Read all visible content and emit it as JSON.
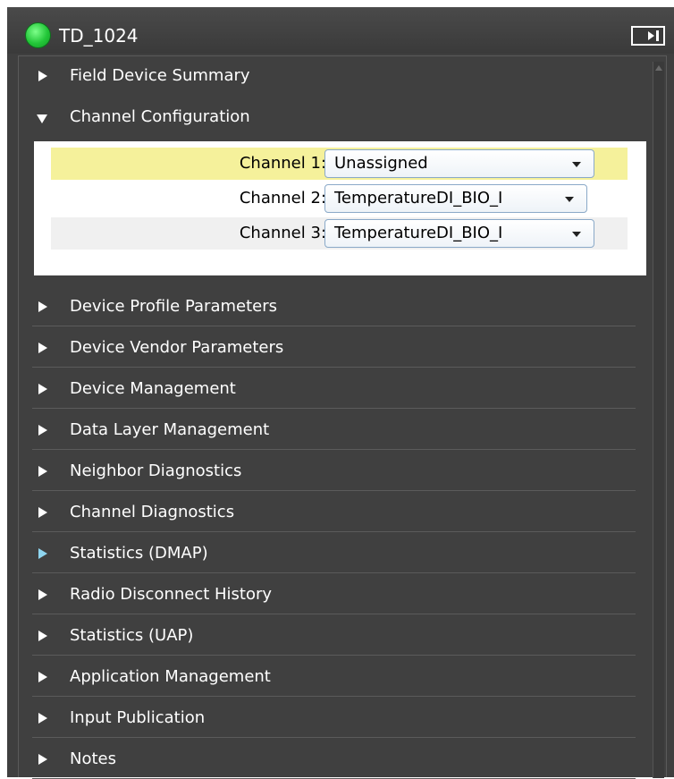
{
  "header": {
    "title": "TD_1024",
    "status_color": "#22c638"
  },
  "sections": [
    {
      "label": "Field Device Summary",
      "expanded": false
    },
    {
      "label": "Channel Configuration",
      "expanded": true
    },
    {
      "label": "Device Profile Parameters",
      "expanded": false
    },
    {
      "label": "Device Vendor Parameters",
      "expanded": false
    },
    {
      "label": "Device Management",
      "expanded": false
    },
    {
      "label": "Data Layer Management",
      "expanded": false
    },
    {
      "label": "Neighbor Diagnostics",
      "expanded": false
    },
    {
      "label": "Channel Diagnostics",
      "expanded": false
    },
    {
      "label": "Statistics (DMAP)",
      "expanded": false,
      "arrow_color": "#8fd6f0"
    },
    {
      "label": "Radio Disconnect History",
      "expanded": false
    },
    {
      "label": "Statistics (UAP)",
      "expanded": false
    },
    {
      "label": "Application Management",
      "expanded": false
    },
    {
      "label": "Input Publication",
      "expanded": false
    },
    {
      "label": "Notes",
      "expanded": false
    }
  ],
  "channels": [
    {
      "label": "Channel 1:",
      "value": "Unassigned"
    },
    {
      "label": "Channel 2:",
      "value": "TemperatureDI_BIO_I"
    },
    {
      "label": "Channel 3:",
      "value": "TemperatureDI_BIO_I"
    }
  ],
  "colors": {
    "panel_bg": "#3f3f3f",
    "highlight_row": "#f5f19b"
  }
}
